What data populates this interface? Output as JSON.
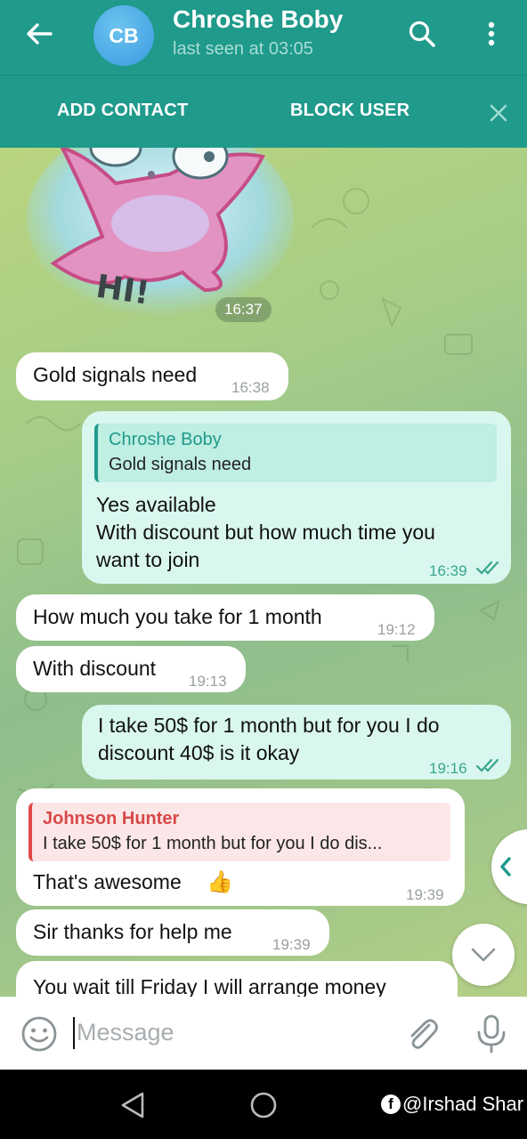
{
  "header": {
    "avatar_initials": "CB",
    "contact_name": "Chroshe Boby",
    "status": "last seen at 03:05",
    "accent_color": "#1f9a8b"
  },
  "action_bar": {
    "add_contact": "ADD CONTACT",
    "block_user": "BLOCK USER"
  },
  "sticker": {
    "text": "HI!",
    "time": "16:37"
  },
  "messages": [
    {
      "direction": "in",
      "text": "Gold signals need",
      "time": "16:38"
    },
    {
      "direction": "out",
      "reply_name": "Chroshe Boby",
      "reply_text": "Gold signals need",
      "lines": [
        "Yes available",
        "With discount but how much time you",
        "want to join"
      ],
      "time": "16:39",
      "read": true
    },
    {
      "direction": "in",
      "text": "How much you take for 1 month",
      "time": "19:12"
    },
    {
      "direction": "in",
      "text": "With discount",
      "time": "19:13"
    },
    {
      "direction": "out",
      "lines": [
        "I take 50$ for 1 month but for you I do",
        "discount 40$ is it okay"
      ],
      "time": "19:16",
      "read": true
    },
    {
      "direction": "in",
      "reply_name": "Johnson Hunter",
      "reply_text": "I take 50$ for 1 month but for you I do dis...",
      "text": "That's awesome",
      "emoji": "👍",
      "time": "19:39"
    },
    {
      "direction": "in",
      "text": "Sir thanks for help me",
      "time": "19:39"
    },
    {
      "direction": "in",
      "text": "You wait till Friday I will arrange money"
    }
  ],
  "input": {
    "placeholder": "Message"
  },
  "watermark": {
    "text": "@Irshad Shar",
    "icon": "facebook-icon"
  },
  "icons": {
    "back": "arrow-left-icon",
    "search": "search-icon",
    "menu": "more-vertical-icon",
    "close": "close-icon",
    "emoji": "smiley-icon",
    "attach": "paperclip-icon",
    "mic": "microphone-icon",
    "scroll": "chevron-down-icon",
    "side": "chevron-left-icon"
  }
}
